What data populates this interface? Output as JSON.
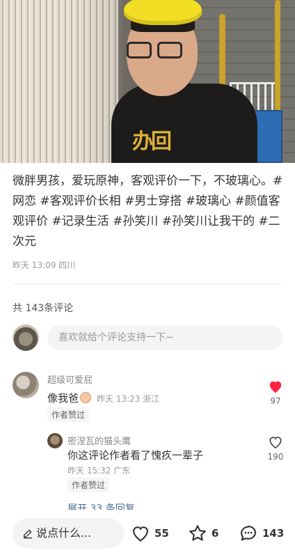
{
  "post": {
    "caption_plain": "微胖男孩，爱玩原神，客观评价一下，不玻璃心。",
    "hashtags": [
      "#网恋",
      "#客观评价长相",
      "#男士穿搭",
      "#玻璃心",
      "#颜值客观评价",
      "#记录生活",
      "#孙笑川",
      "#孙笑川让我干的",
      "#二次元"
    ],
    "meta": "昨天 13:09 四川",
    "shirt_print": "办回"
  },
  "comments_header": "共 143条评论",
  "comment_input_placeholder": "喜欢就给个评论支持一下~",
  "comments": [
    {
      "user": "超级可爱屁",
      "text": "像我爸",
      "meta": "昨天 13:23 浙江",
      "badge": "作者赞过",
      "likes": "97",
      "liked": true
    }
  ],
  "reply": {
    "user": "密涅瓦的猫头鹰",
    "text": "你这评论作者看了愧疚一辈子",
    "meta": "昨天 15:32 广东",
    "badge": "作者赞过",
    "likes": "190"
  },
  "expand_replies": "展开 33 条回复",
  "bottom": {
    "say_placeholder": "说点什么...",
    "likes": "55",
    "favorites": "6",
    "comments": "143"
  },
  "icons": {
    "edit": "pencil-icon",
    "like": "heart-icon",
    "favorite": "star-icon",
    "comment": "chat-bubble-icon"
  },
  "colors": {
    "liked_heart": "#ff2442",
    "link": "#4a6b96"
  }
}
